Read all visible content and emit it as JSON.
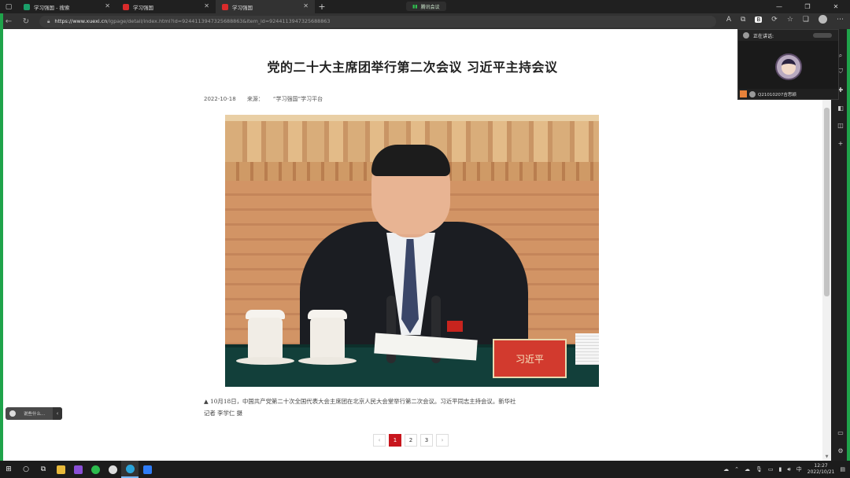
{
  "browser": {
    "tabs": [
      {
        "label": "学习强国 - 搜索",
        "favicon": "green",
        "active": false
      },
      {
        "label": "学习强国",
        "favicon": "red",
        "active": false
      },
      {
        "label": "学习强国",
        "favicon": "red",
        "active": true
      }
    ],
    "new_tab": "+",
    "meeting_indicator": "腾讯会议",
    "url_host": "https://www.xuexi.cn",
    "url_path": "/lgpage/detail/index.html?id=9244113947325688863&item_id=9244113947325688863"
  },
  "article": {
    "title": "党的二十大主席团举行第二次会议 习近平主持会议",
    "date": "2022-10-18",
    "source_label": "来源：",
    "source": "“学习强国”学习平台",
    "nameplate_text": "习近平",
    "caption_line1": "▲ 10月18日，中国共产党第二十次全国代表大会主席团在北京人民大会堂举行第二次会议。习近平同志主持会议。新华社",
    "caption_line2": "记者 李学仁 摄"
  },
  "pagination": {
    "prev": "‹",
    "pages": [
      "1",
      "2",
      "3"
    ],
    "current": "1",
    "next": "›"
  },
  "chat_bubble": {
    "placeholder": "说些什么...",
    "toggle": "‹"
  },
  "call_window": {
    "speaking_label": "正在讲话:",
    "participant": "Q21010207吉思颖"
  },
  "taskbar": {
    "time": "12:27",
    "date": "2022/10/21",
    "ime": "中"
  },
  "colors": {
    "accent_red": "#c8161d",
    "edge_green": "#1fa34a"
  }
}
